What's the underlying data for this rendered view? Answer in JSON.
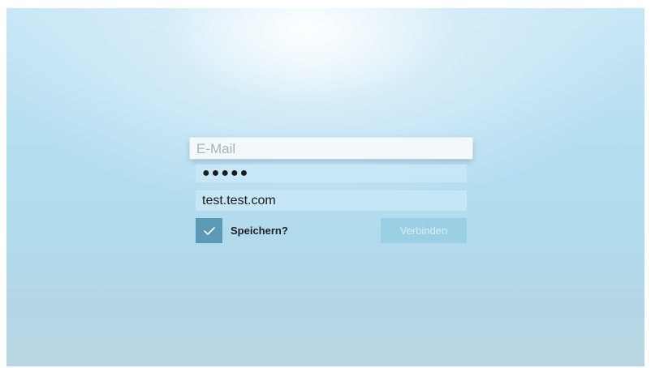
{
  "login_form": {
    "email": {
      "placeholder": "E-Mail",
      "value": ""
    },
    "password": {
      "masked_value": "●●●●●"
    },
    "server": {
      "value": "test.test.com"
    },
    "remember": {
      "label": "Speichern?",
      "checked": true,
      "icon": "checkmark-icon"
    },
    "connect_button": {
      "label": "Verbinden",
      "enabled": false
    }
  },
  "colors": {
    "checkbox_fill": "#5a9ab4",
    "button_disabled_fill": "#96cde2",
    "button_disabled_text": "#d6eef8"
  }
}
